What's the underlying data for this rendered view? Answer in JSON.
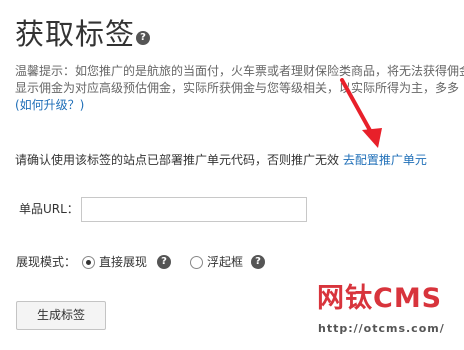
{
  "page": {
    "title": "获取标签",
    "title_help_icon": "help-icon"
  },
  "tip": {
    "line1": "温馨提示：如您推广的是航旅的当面付，火车票或者理财保险类商品，将无法获得佣金",
    "line2": "显示佣金为对应高级预估佣金，实际所获佣金与您等级相关，以实际所得为主，多多",
    "upgrade_link": "(如何升级？)"
  },
  "confirm": {
    "text": "请确认使用该标签的站点已部署推广单元代码，否则推广无效",
    "link": "去配置推广单元"
  },
  "form": {
    "url_label": "单品URL：",
    "url_value": "",
    "mode_label": "展现模式：",
    "options": [
      {
        "label": "直接展现",
        "checked": true,
        "icon": "help-icon"
      },
      {
        "label": "浮起框",
        "checked": false,
        "icon": "help-icon"
      }
    ],
    "submit_label": "生成标签"
  },
  "watermark": {
    "brand": "网钛CMS",
    "url": "http://otcms.com/"
  },
  "colors": {
    "link": "#1f6fb8",
    "arrow": "#e8202a",
    "watermark": "#d8343c"
  }
}
